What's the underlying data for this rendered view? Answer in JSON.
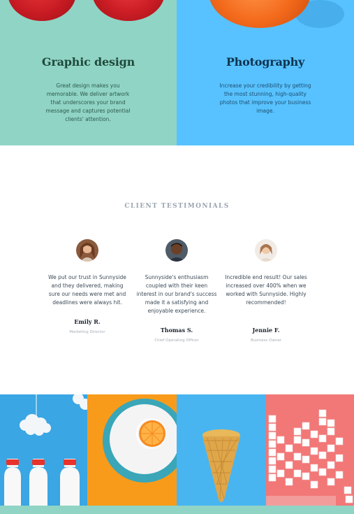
{
  "services": [
    {
      "title": "Graphic design",
      "description": "Great design makes you memorable. We deliver artwork that underscores your brand message and captures potential clients' attention."
    },
    {
      "title": "Photography",
      "description": "Increase your credibility by getting the most stunning, high-quality photos that improve your business image."
    }
  ],
  "testimonials": {
    "heading": "CLIENT TESTIMONIALS",
    "items": [
      {
        "quote": "We put our trust in Sunnyside and they delivered, making sure our needs were met and deadlines were always hit.",
        "name": "Emily R.",
        "role": "Marketing Director"
      },
      {
        "quote": "Sunnyside's enthusiasm coupled with their keen interest in our brand's success made it a satisfying and enjoyable experience.",
        "name": "Thomas S.",
        "role": "Chief Operating Officer"
      },
      {
        "quote": "Incredible end result! Our sales increased over 400% when we worked with Sunnyside. Highly recommended!",
        "name": "Jennie F.",
        "role": "Business Owner"
      }
    ]
  },
  "colors": {
    "graphic_bg": "#90d4c5",
    "photo_bg": "#57c2ff",
    "footer": "#90d4c5"
  }
}
